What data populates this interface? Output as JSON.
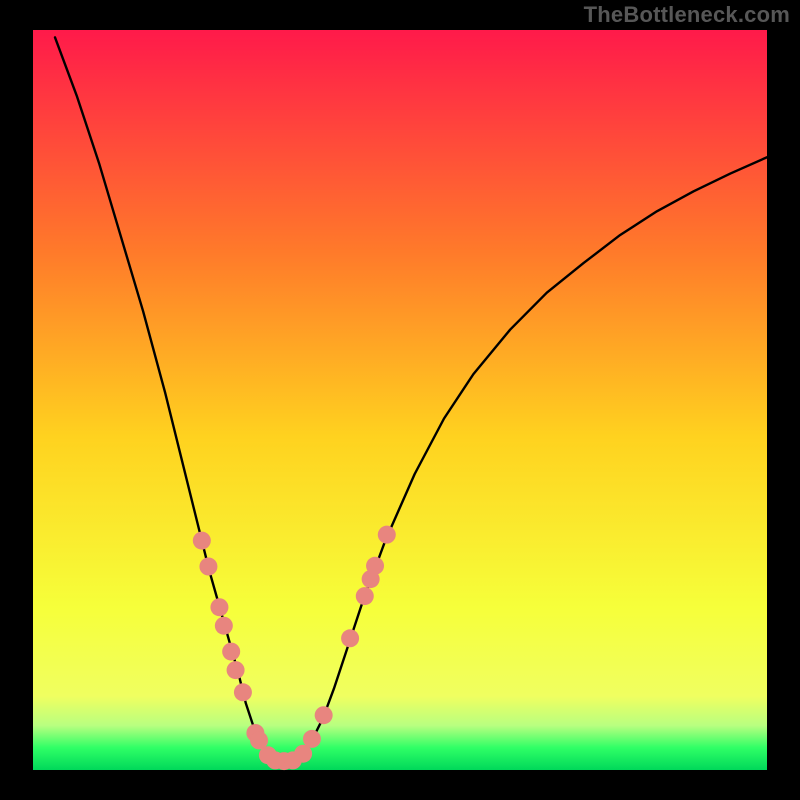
{
  "watermark": "TheBottleneck.com",
  "colors": {
    "black": "#000000",
    "curve": "#000000",
    "marker_fill": "#e8857f",
    "marker_stroke": "#c96a63",
    "gradient_top": "#ff1a4a",
    "gradient_mid1": "#ff7a2a",
    "gradient_mid2": "#ffd21f",
    "gradient_mid3": "#f6ff3a",
    "gradient_bottom_yellow": "#f0ff60",
    "gradient_green_light": "#b8ff80",
    "gradient_green": "#2fff66",
    "gradient_green_deep": "#00d85a"
  },
  "plot": {
    "inner_x": 33,
    "inner_y": 30,
    "inner_w": 734,
    "inner_h": 740
  },
  "chart_data": {
    "type": "line",
    "title": "",
    "xlabel": "",
    "ylabel": "",
    "xlim": [
      0,
      100
    ],
    "ylim": [
      0,
      100
    ],
    "curve": [
      {
        "x": 3,
        "y": 99
      },
      {
        "x": 6,
        "y": 91
      },
      {
        "x": 9,
        "y": 82
      },
      {
        "x": 12,
        "y": 72
      },
      {
        "x": 15,
        "y": 62
      },
      {
        "x": 18,
        "y": 51
      },
      {
        "x": 20,
        "y": 43
      },
      {
        "x": 22,
        "y": 35
      },
      {
        "x": 24,
        "y": 27
      },
      {
        "x": 26,
        "y": 20
      },
      {
        "x": 28,
        "y": 13
      },
      {
        "x": 29,
        "y": 9
      },
      {
        "x": 30,
        "y": 6
      },
      {
        "x": 31,
        "y": 3.5
      },
      {
        "x": 32,
        "y": 2
      },
      {
        "x": 33.5,
        "y": 1.2
      },
      {
        "x": 35,
        "y": 1.2
      },
      {
        "x": 36.5,
        "y": 2
      },
      {
        "x": 38,
        "y": 4
      },
      {
        "x": 39.5,
        "y": 7
      },
      {
        "x": 41,
        "y": 11
      },
      {
        "x": 43,
        "y": 17
      },
      {
        "x": 45,
        "y": 23
      },
      {
        "x": 48,
        "y": 31
      },
      {
        "x": 52,
        "y": 40
      },
      {
        "x": 56,
        "y": 47.5
      },
      {
        "x": 60,
        "y": 53.5
      },
      {
        "x": 65,
        "y": 59.5
      },
      {
        "x": 70,
        "y": 64.5
      },
      {
        "x": 75,
        "y": 68.5
      },
      {
        "x": 80,
        "y": 72.3
      },
      {
        "x": 85,
        "y": 75.5
      },
      {
        "x": 90,
        "y": 78.2
      },
      {
        "x": 95,
        "y": 80.6
      },
      {
        "x": 100,
        "y": 82.8
      }
    ],
    "markers": [
      {
        "x": 23.0,
        "y": 31
      },
      {
        "x": 23.9,
        "y": 27.5
      },
      {
        "x": 25.4,
        "y": 22
      },
      {
        "x": 26.0,
        "y": 19.5
      },
      {
        "x": 27.0,
        "y": 16
      },
      {
        "x": 27.6,
        "y": 13.5
      },
      {
        "x": 28.6,
        "y": 10.5
      },
      {
        "x": 30.3,
        "y": 5
      },
      {
        "x": 30.8,
        "y": 4
      },
      {
        "x": 32.0,
        "y": 2
      },
      {
        "x": 33.0,
        "y": 1.3
      },
      {
        "x": 34.2,
        "y": 1.2
      },
      {
        "x": 35.4,
        "y": 1.3
      },
      {
        "x": 36.8,
        "y": 2.2
      },
      {
        "x": 38.0,
        "y": 4.2
      },
      {
        "x": 39.6,
        "y": 7.4
      },
      {
        "x": 43.2,
        "y": 17.8
      },
      {
        "x": 45.2,
        "y": 23.5
      },
      {
        "x": 46.0,
        "y": 25.8
      },
      {
        "x": 46.6,
        "y": 27.6
      },
      {
        "x": 48.2,
        "y": 31.8
      }
    ]
  }
}
